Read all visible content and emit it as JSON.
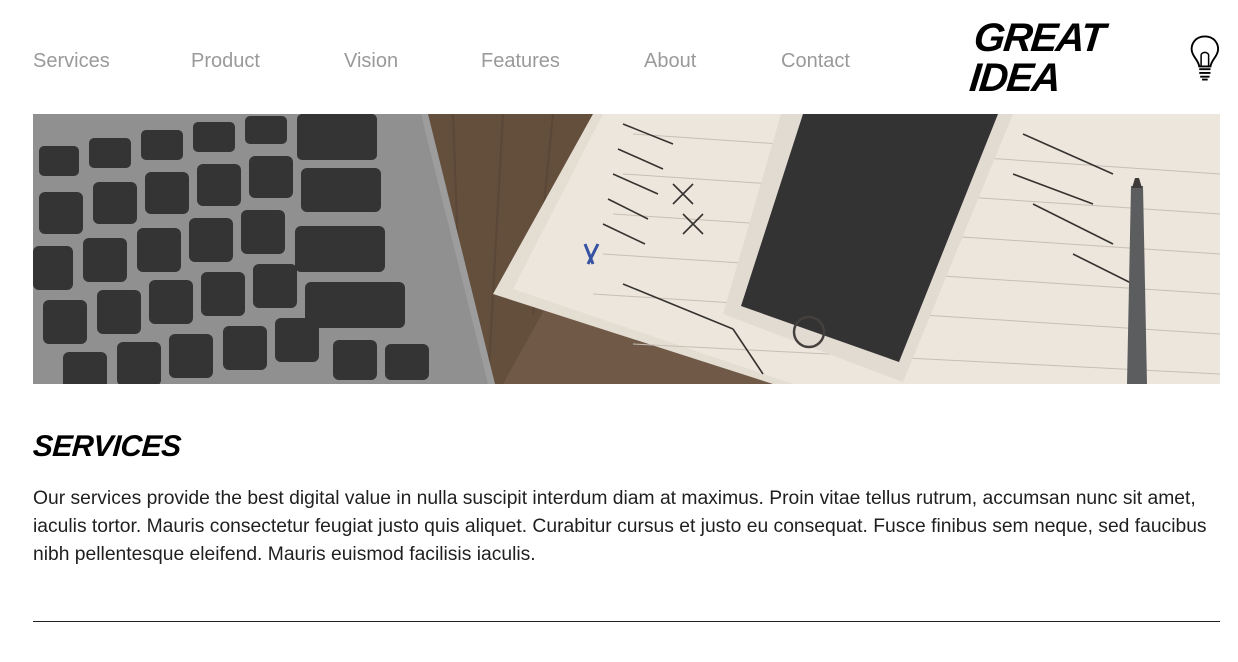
{
  "nav": {
    "items": [
      {
        "label": "Services"
      },
      {
        "label": "Product"
      },
      {
        "label": "Vision"
      },
      {
        "label": "Features"
      },
      {
        "label": "About"
      },
      {
        "label": "Contact"
      }
    ]
  },
  "logo": {
    "text": "GREAT IDEA",
    "icon": "lightbulb-icon"
  },
  "hero": {
    "icon": "workspace-photo"
  },
  "section": {
    "title": "SERVICES",
    "body": "Our services provide the best digital value in nulla suscipit interdum diam at maximus. Proin vitae tellus rutrum, accumsan nunc sit amet, iaculis tortor. Mauris consectetur feugiat justo quis aliquet. Curabitur cursus et justo eu consequat. Fusce finibus sem neque, sed faucibus nibh pellentesque eleifend. Mauris euismod facilisis iaculis."
  },
  "colors": {
    "nav_text": "#9a9a9a",
    "body_text": "#1f1f1f",
    "divider": "#222222"
  }
}
